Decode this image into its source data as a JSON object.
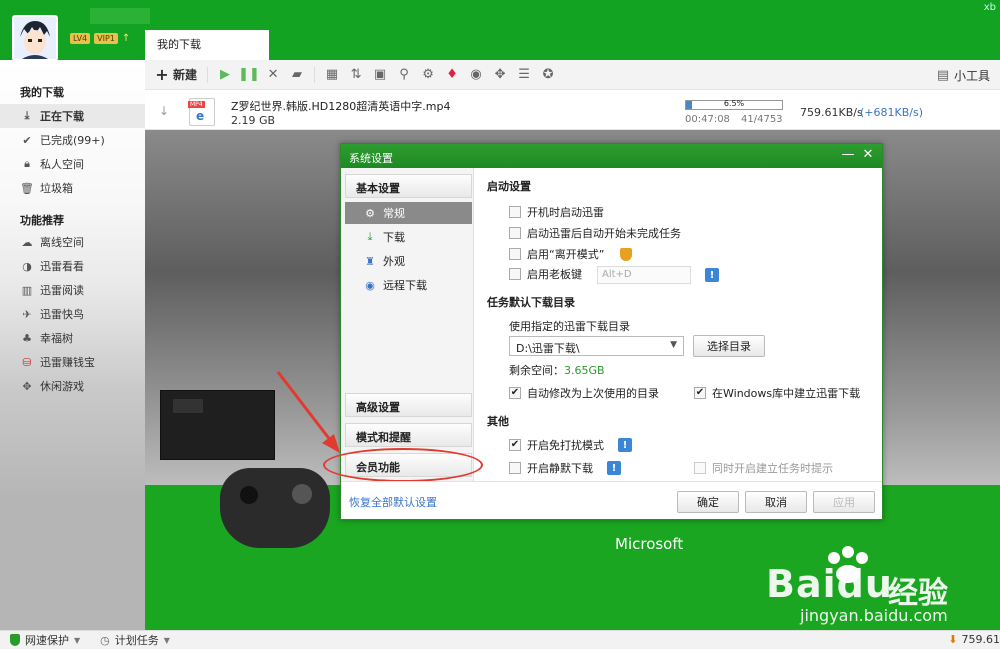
{
  "header": {
    "badges": [
      "LV4",
      "VIP1"
    ],
    "corner_text": "xb",
    "active_tab": "我的下载"
  },
  "toolbar": {
    "new_label": "新建",
    "tools_label": "小工具"
  },
  "sidebar": {
    "section1": "我的下载",
    "items": [
      {
        "label": "正在下载",
        "icon": "download-icon"
      },
      {
        "label": "已完成(99+)",
        "icon": "check-icon"
      },
      {
        "label": "私人空间",
        "icon": "lock-icon"
      },
      {
        "label": "垃圾箱",
        "icon": "trash-icon"
      }
    ],
    "section2": "功能推荐",
    "features": [
      {
        "label": "离线空间",
        "icon": "cloud-icon"
      },
      {
        "label": "迅雷看看",
        "icon": "play-icon"
      },
      {
        "label": "迅雷阅读",
        "icon": "book-icon"
      },
      {
        "label": "迅雷快鸟",
        "icon": "bird-icon"
      },
      {
        "label": "幸福树",
        "icon": "tree-icon"
      },
      {
        "label": "迅雷赚钱宝",
        "icon": "money-icon"
      },
      {
        "label": "休闲游戏",
        "icon": "gamepad-icon"
      }
    ]
  },
  "download": {
    "file_type": "MP4",
    "name": "Z罗纪世界.韩版.HD1280超清英语中字.mp4",
    "size": "2.19 GB",
    "progress": 6.5,
    "progress_label": "6.5%",
    "time_left": "00:47:08",
    "parts": "41/4753",
    "speed": "759.61KB/s",
    "speed_boost": "(+681KB/s)"
  },
  "background": {
    "brand": "Microsoft"
  },
  "dialog": {
    "title": "系统设置",
    "categories": {
      "basic": "基本设置",
      "advanced": "高级设置",
      "mode": "模式和提醒",
      "member": "会员功能"
    },
    "sub_items": [
      {
        "label": "常规",
        "icon": "gear-icon"
      },
      {
        "label": "下载",
        "icon": "download-icon"
      },
      {
        "label": "外观",
        "icon": "shirt-icon"
      },
      {
        "label": "远程下载",
        "icon": "globe-icon"
      }
    ],
    "startup": {
      "title": "启动设置",
      "opt1": "开机时启动迅雷",
      "opt2": "启动迅雷后自动开始未完成任务",
      "opt3": "启用“离开模式”",
      "opt4": "启用老板键",
      "boss_key": "Alt+D"
    },
    "dir": {
      "title": "任务默认下载目录",
      "label": "使用指定的迅雷下载目录",
      "path": "D:\\迅雷下载\\",
      "choose_btn": "选择目录",
      "free_label": "剩余空间：",
      "free_value": "3.65GB",
      "auto_last": "自动修改为上次使用的目录",
      "win_lib": "在Windows库中建立迅雷下载"
    },
    "other": {
      "title": "其他",
      "no_disturb": "开启免打扰模式",
      "silent": "开启静默下载",
      "create_tip": "同时开启建立任务时提示"
    },
    "footer": {
      "restore": "恢复全部默认设置",
      "ok": "确定",
      "cancel": "取消",
      "apply": "应用"
    }
  },
  "statusbar": {
    "net_protect": "网速保护",
    "plan": "计划任务",
    "speed": "759.61"
  },
  "watermark": {
    "brand": "Bai",
    "brand2": "du",
    "cn": "经验",
    "url": "jingyan.baidu.com"
  },
  "colors": {
    "brand_green": "#1aa620",
    "link_blue": "#3a74c9",
    "highlight_red": "#e23a2e"
  }
}
